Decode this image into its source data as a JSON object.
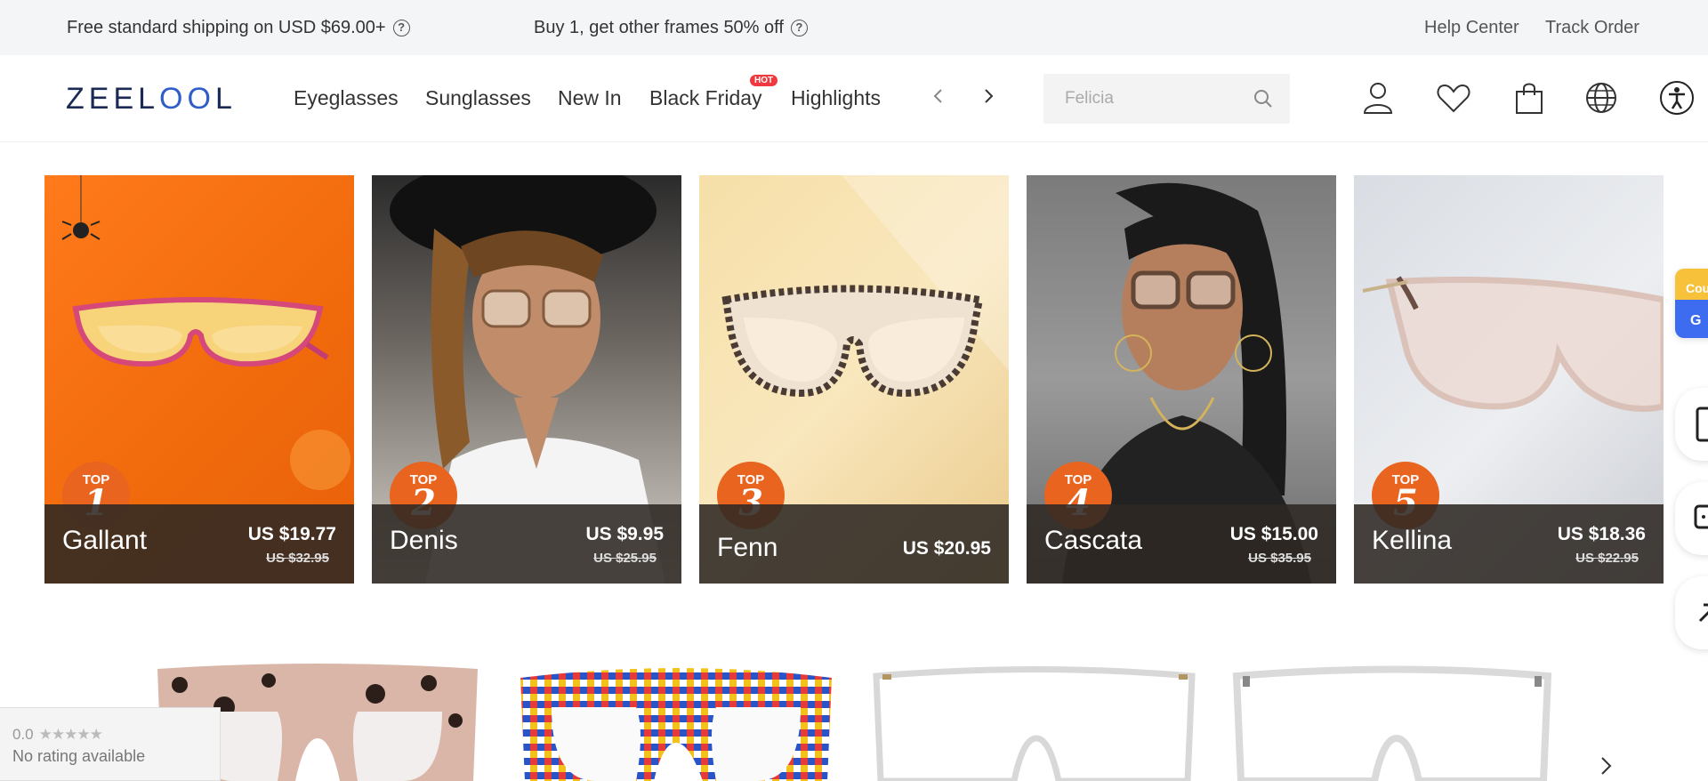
{
  "promo": {
    "shipping": "Free standard shipping on USD $69.00+",
    "frames_offer": "Buy 1, get other frames 50% off",
    "help_center": "Help Center",
    "track_order": "Track Order"
  },
  "header": {
    "logo": {
      "a": "ZEEL",
      "b": "OO",
      "c": "L"
    },
    "nav": [
      "Eyeglasses",
      "Sunglasses",
      "New In",
      "Black Friday",
      "Highlights"
    ],
    "hot_badge": "HOT",
    "search_placeholder": "Felicia"
  },
  "products": [
    {
      "rank": "1",
      "top": "TOP",
      "name": "Gallant",
      "price": "US $19.77",
      "original": "US $32.95"
    },
    {
      "rank": "2",
      "top": "TOP",
      "name": "Denis",
      "price": "US $9.95",
      "original": "US $25.95"
    },
    {
      "rank": "3",
      "top": "TOP",
      "name": "Fenn",
      "price": "US $20.95",
      "original": ""
    },
    {
      "rank": "4",
      "top": "TOP",
      "name": "Cascata",
      "price": "US $15.00",
      "original": "US $35.95"
    },
    {
      "rank": "5",
      "top": "TOP",
      "name": "Kellina",
      "price": "US $18.36",
      "original": "US $22.95"
    }
  ],
  "side": {
    "coupon_a": "Cou",
    "coupon_b": "G"
  },
  "rating": {
    "score": "0.0",
    "stars": "★★★★★",
    "text": "No rating available"
  },
  "colors": {
    "accent": "#e8641f",
    "hot": "#f0393e",
    "logo": "#1b2a55",
    "logo_accent": "#2f5ec8"
  }
}
